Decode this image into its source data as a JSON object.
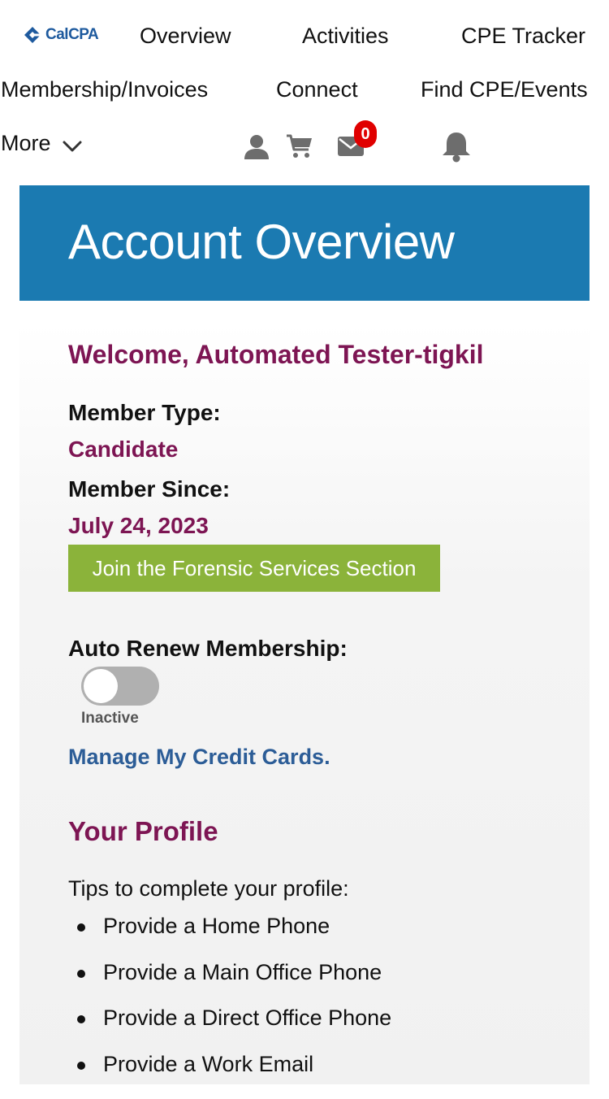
{
  "nav": {
    "logo_text": "CalCPA",
    "items": [
      "Overview",
      "Activities",
      "CPE Tracker",
      "Membership/Invoices",
      "Connect",
      "Find CPE/Events",
      "More"
    ],
    "icons": [
      "user-icon",
      "cart-icon",
      "mail-icon",
      "bell-icon",
      "chevron-down-icon"
    ],
    "message_count": "0"
  },
  "hero": {
    "title": "Account Overview"
  },
  "account": {
    "welcome": "Welcome, Automated Tester-tigkil",
    "member_type_label": "Member Type:",
    "member_type": "Candidate",
    "member_since_label": "Member Since:",
    "member_since": "July 24, 2023",
    "join_button": "Join the Forensic Services Section",
    "auto_renew_label": "Auto Renew Membership:",
    "auto_renew_status": "Inactive",
    "credit_cards_link": "Manage My Credit Cards."
  },
  "profile": {
    "title": "Your Profile",
    "tips_intro": "Tips to complete your profile:",
    "tips": [
      "Provide a Home Phone",
      "Provide a Main Office Phone",
      "Provide a Direct Office Phone",
      "Provide a Work Email"
    ]
  },
  "colors": {
    "brand_blue": "#1b7ab1",
    "accent_maroon": "#7d1553",
    "button_green": "#8bb33a",
    "link_blue": "#2c5d97",
    "badge_red": "#e00000"
  }
}
